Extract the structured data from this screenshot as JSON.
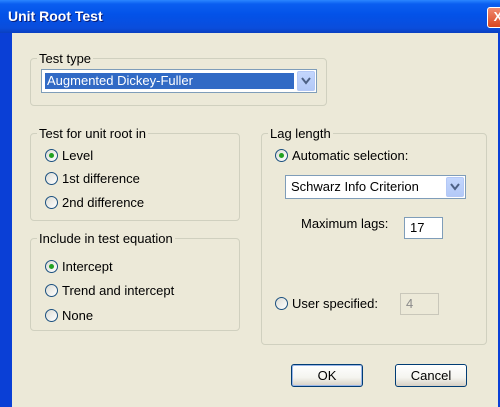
{
  "window": {
    "title": "Unit Root Test",
    "close_label": "X"
  },
  "test_type": {
    "legend": "Test type",
    "selected": "Augmented Dickey-Fuller"
  },
  "unit_root_in": {
    "legend": "Test for unit root in",
    "options": [
      "Level",
      "1st difference",
      "2nd difference"
    ],
    "checked": "Level"
  },
  "include": {
    "legend": "Include in test equation",
    "options": [
      "Intercept",
      "Trend and intercept",
      "None"
    ],
    "checked": "Intercept"
  },
  "lag_length": {
    "legend": "Lag length",
    "automatic_label": "Automatic selection:",
    "criterion": "Schwarz Info Criterion",
    "max_lags_label": "Maximum lags:",
    "max_lags_value": "17",
    "user_specified_label": "User specified:",
    "user_specified_value": "4",
    "checked": "automatic"
  },
  "buttons": {
    "ok": "OK",
    "cancel": "Cancel"
  },
  "colors": {
    "title_bar": "#0352e8",
    "dialog_bg": "#ece9d8",
    "selection": "#316ac5",
    "radio_dot": "#21a121"
  }
}
